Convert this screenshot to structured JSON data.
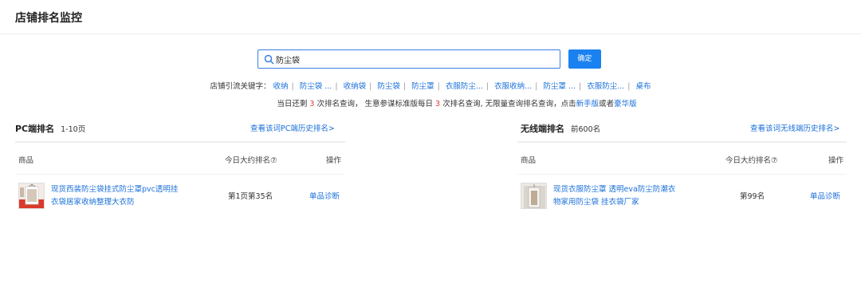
{
  "header": {
    "title": "店铺排名监控"
  },
  "search": {
    "value": "防尘袋",
    "button_label": "确定"
  },
  "keywords": {
    "label": "店铺引流关键字：",
    "items": [
      "收纳",
      "防尘袋 ...",
      "收纳袋",
      "防尘袋",
      "防尘罩",
      "衣服防尘...",
      "衣服收纳...",
      "防尘罩 ...",
      "衣服防尘...",
      "桌布"
    ]
  },
  "quota": {
    "text_1": "当日还剩",
    "remaining_1": "3",
    "text_2": "次排名查询， 生意参谋标准版每日",
    "remaining_2": "3",
    "text_3": "次排名查询, 无限量查询排名查询，点击",
    "link_1": "新手版",
    "text_4": "或者",
    "link_2": "豪华版"
  },
  "pc": {
    "title": "PC端排名",
    "subtitle": "1-10页",
    "history_link": "查看该词PC端历史排名>",
    "columns": {
      "product": "商品",
      "rank": "今日大约排名⑦",
      "action": "操作"
    },
    "rows": [
      {
        "title": "现货西装防尘袋挂式防尘罩pvc透明挂衣袋居家收纳整理大衣防",
        "rank": "第1页第35名",
        "action": "单品诊断"
      }
    ]
  },
  "mobile": {
    "title": "无线端排名",
    "subtitle": "前600名",
    "history_link": "查看该词无线端历史排名>",
    "columns": {
      "product": "商品",
      "rank": "今日大约排名⑦",
      "action": "操作"
    },
    "rows": [
      {
        "title": "现货衣服防尘罩 透明eva防尘防潮衣物家用防尘袋 挂衣袋厂家",
        "rank": "第99名",
        "action": "单品诊断"
      }
    ]
  }
}
